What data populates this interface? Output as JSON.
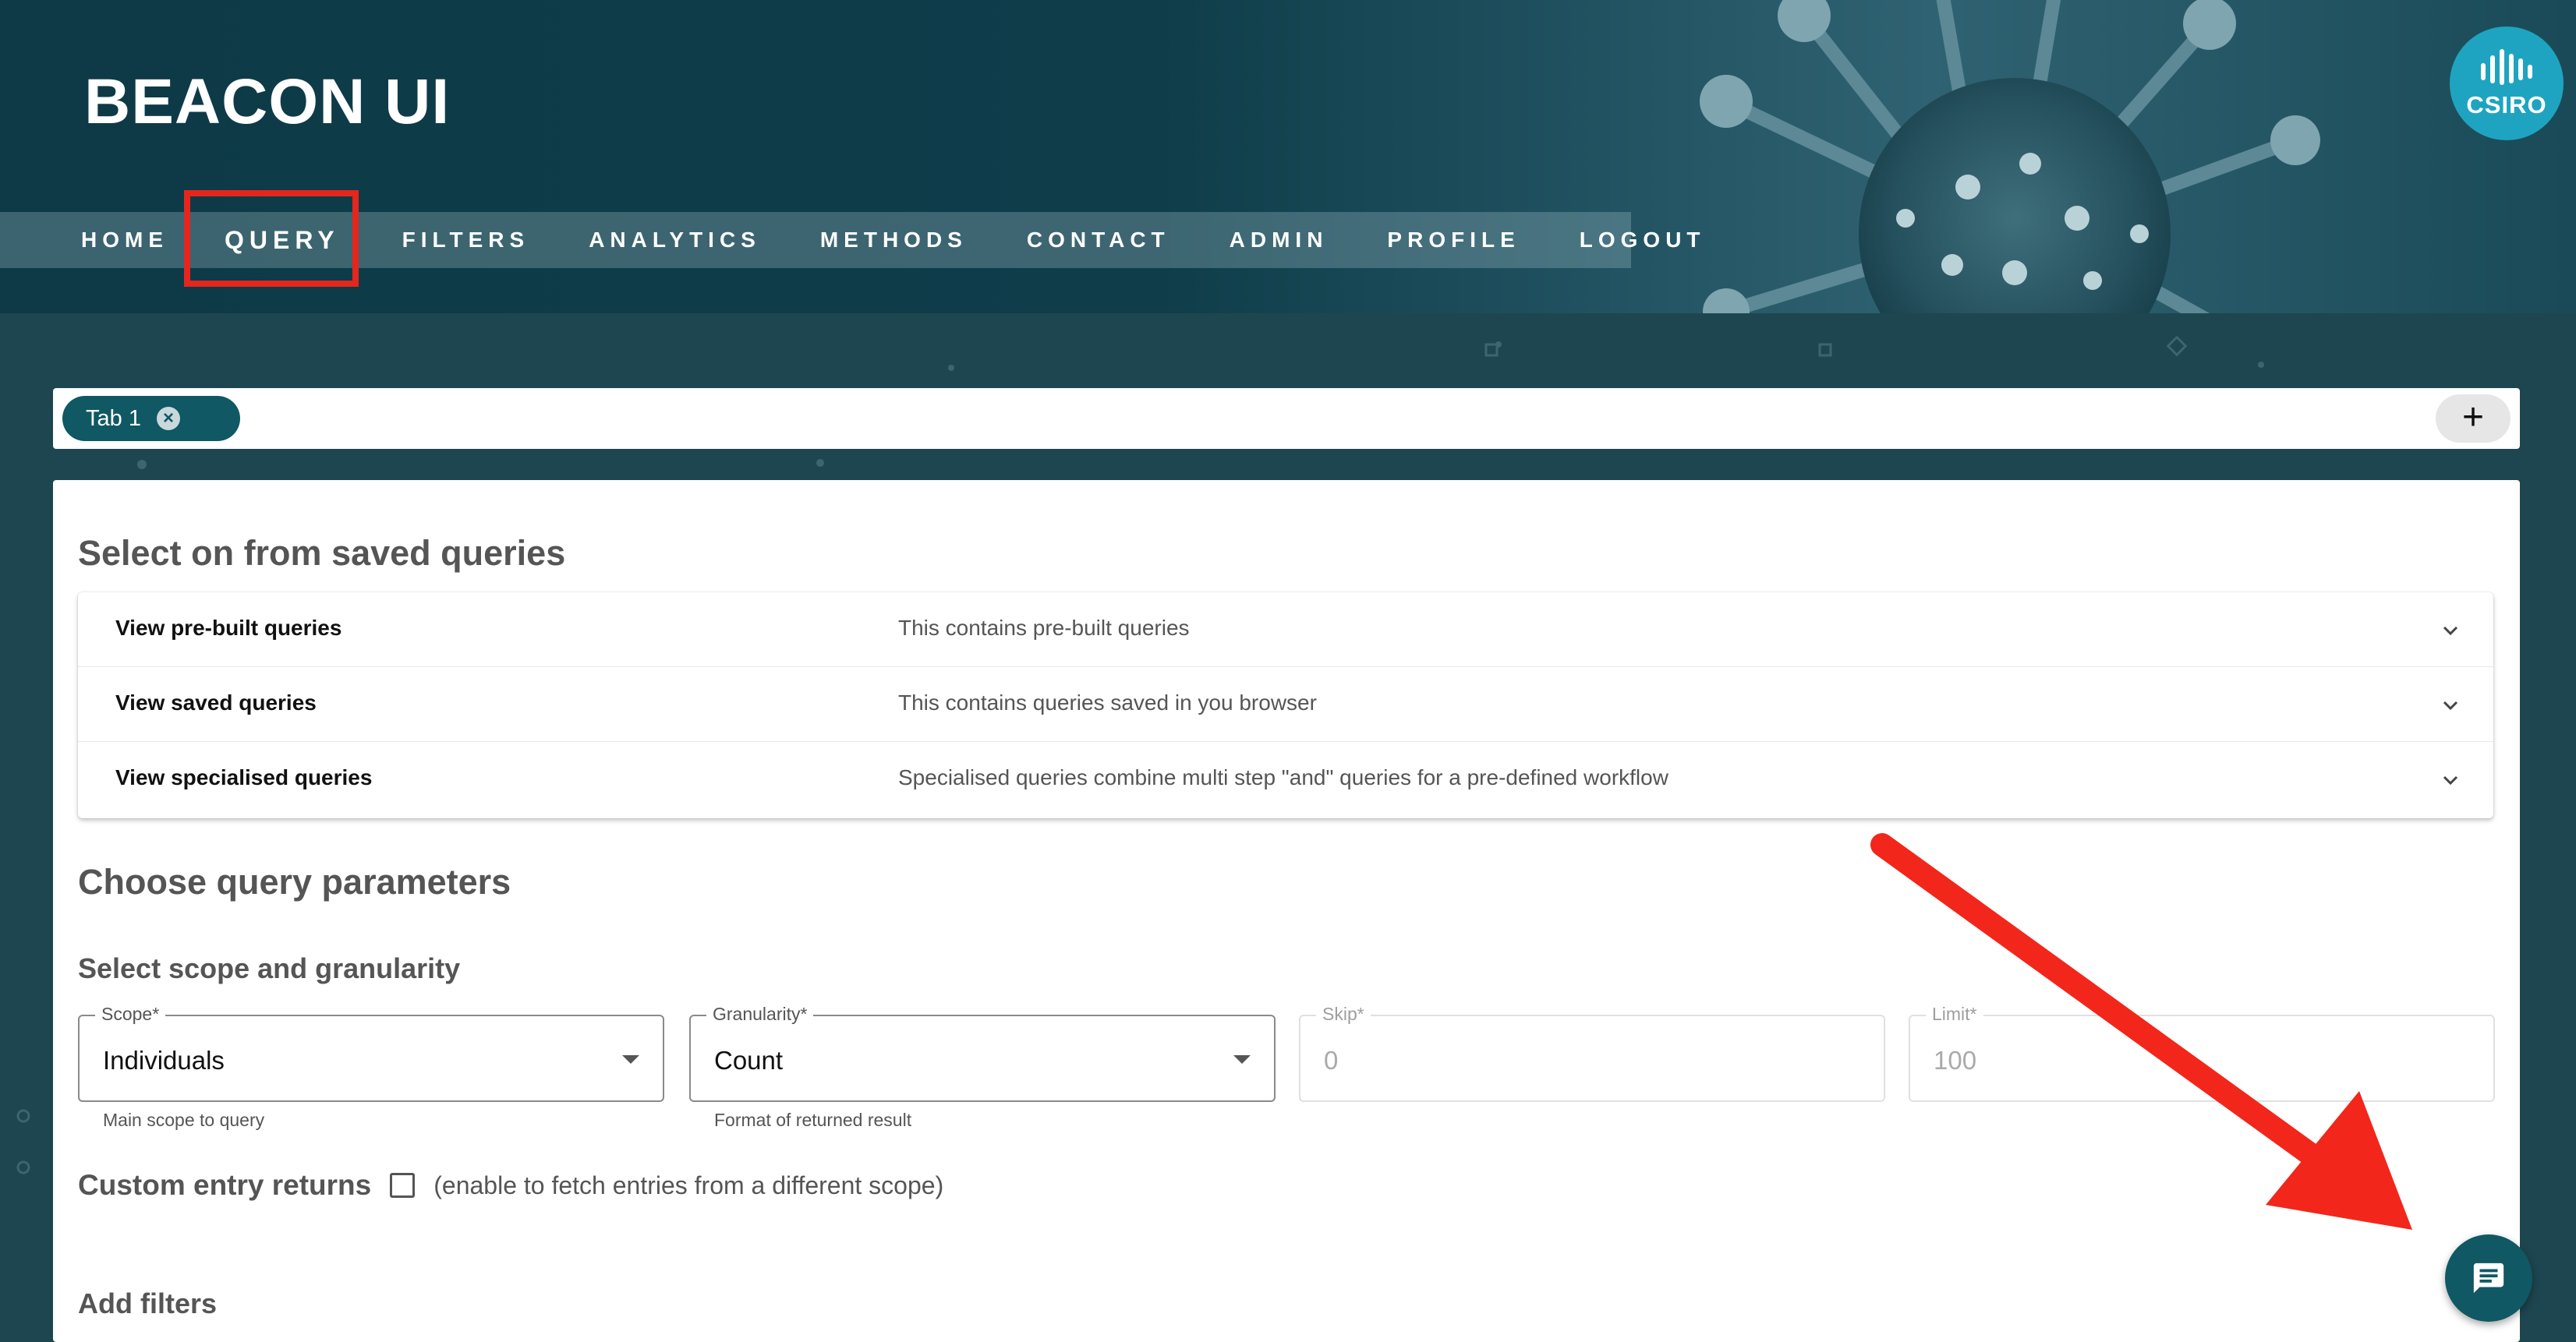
{
  "header": {
    "app_title": "BEACON UI",
    "logo_text": "CSIRO"
  },
  "nav": {
    "items": [
      {
        "label": "HOME"
      },
      {
        "label": "QUERY",
        "active": true
      },
      {
        "label": "FILTERS"
      },
      {
        "label": "ANALYTICS"
      },
      {
        "label": "METHODS"
      },
      {
        "label": "CONTACT"
      },
      {
        "label": "ADMIN"
      },
      {
        "label": "PROFILE"
      },
      {
        "label": "LOGOUT"
      }
    ]
  },
  "tabs": {
    "items": [
      {
        "label": "Tab 1"
      }
    ],
    "add_icon": "plus-icon",
    "close_icon": "close-circle-icon"
  },
  "saved_queries": {
    "title": "Select on from saved queries",
    "rows": [
      {
        "title": "View pre-built queries",
        "description": "This contains pre-built queries"
      },
      {
        "title": "View saved queries",
        "description": "This contains queries saved in you browser"
      },
      {
        "title": "View specialised queries",
        "description": "Specialised queries combine multi step \"and\" queries for a pre-defined workflow"
      }
    ]
  },
  "query_params": {
    "title": "Choose query parameters",
    "scope_section_title": "Select scope and granularity",
    "fields": {
      "scope": {
        "label": "Scope*",
        "value": "Individuals",
        "helper": "Main scope to query"
      },
      "granularity": {
        "label": "Granularity*",
        "value": "Count",
        "helper": "Format of returned result"
      },
      "skip": {
        "label": "Skip*",
        "value": "0",
        "disabled": true
      },
      "limit": {
        "label": "Limit*",
        "value": "100",
        "disabled": true
      }
    },
    "custom_entry": {
      "label": "Custom entry returns",
      "checked": false,
      "hint": "(enable to fetch entries from a different scope)"
    },
    "filters_title": "Add filters"
  },
  "fab": {
    "icon": "chat-message-icon"
  },
  "annotations": {
    "highlight_color": "#e5261d",
    "arrow_color": "#f2261b"
  },
  "colors": {
    "primary": "#0f5864",
    "header_bg": "#0e3a47",
    "page_bg": "#1e4650",
    "logo": "#1ea4c0"
  }
}
